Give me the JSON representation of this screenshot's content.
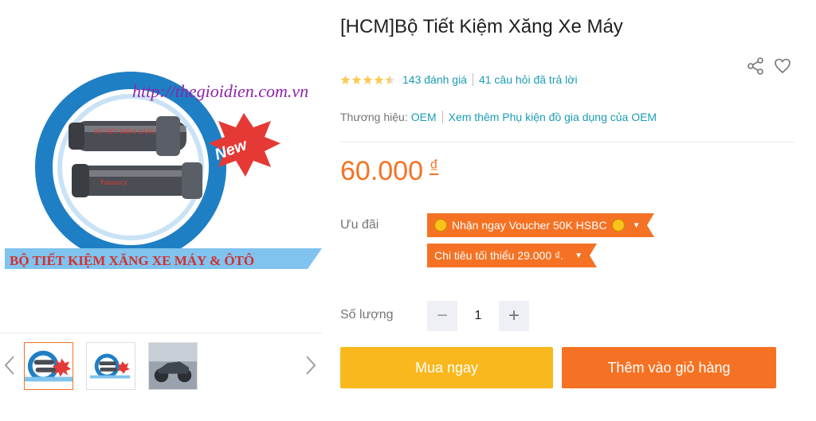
{
  "product": {
    "title": "[HCM]Bộ Tiết Kiệm Xăng Xe Máy",
    "rating_count": "143 đánh giá",
    "questions": "41 câu hỏi đã trả lời",
    "brand_label": "Thương hiệu:",
    "brand": "OEM",
    "more_link": "Xem thêm Phụ kiện đồ gia dụng của OEM",
    "price": "60.000",
    "currency": "₫",
    "stars": 4.5
  },
  "image": {
    "url_text": "http://thegioidien.com.vn",
    "banner_text": "BỘ TIẾT KIỆM XĂNG XE MÁY & ÔTÔ",
    "badge_text": "New",
    "tube_text_1": "BỘ TIẾT KIỆM XĂNG",
    "tube_text_2": "Panasucy"
  },
  "promo": {
    "label": "Ưu đãi",
    "voucher1": "Nhận ngay Voucher 50K HSBC",
    "voucher2": "Chi tiêu tối thiểu 29.000 ₫."
  },
  "quantity": {
    "label": "Số lượng",
    "value": "1",
    "minus": "−",
    "plus": "+"
  },
  "actions": {
    "buy_now": "Mua ngay",
    "add_to_cart": "Thêm vào giỏ hàng"
  },
  "colors": {
    "accent": "#f57224",
    "buy": "#f9b81d",
    "link": "#1a9cb7"
  },
  "icons": [
    "share-icon",
    "heart-icon",
    "chevron-left-icon",
    "chevron-right-icon",
    "star-icon",
    "caret-down-icon"
  ]
}
